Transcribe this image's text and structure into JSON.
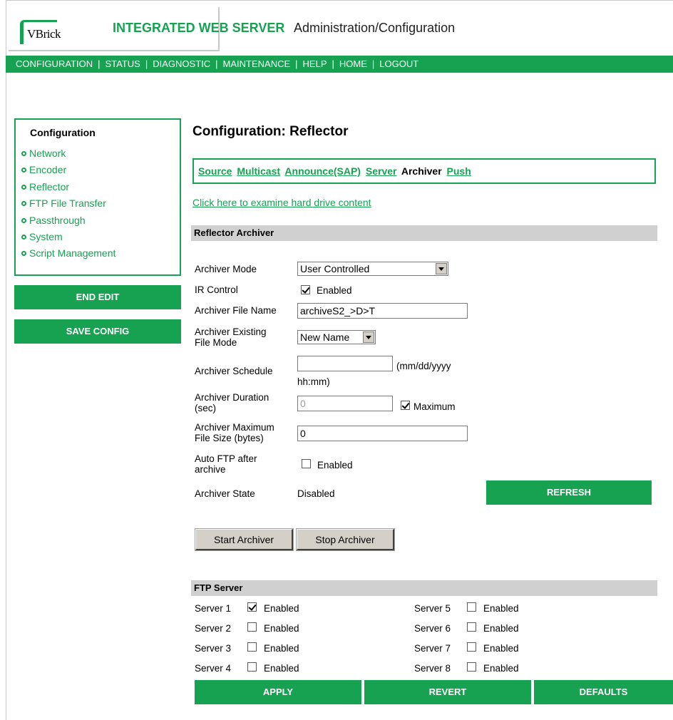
{
  "header": {
    "logo_text": "VBrick",
    "title": "INTEGRATED WEB SERVER",
    "subtitle": "Administration/Configuration"
  },
  "nav": {
    "items": [
      "CONFIGURATION",
      "STATUS",
      "DIAGNOSTIC",
      "MAINTENANCE",
      "HELP",
      "HOME",
      "LOGOUT"
    ]
  },
  "sidebar": {
    "title": "Configuration",
    "items": [
      "Network",
      "Encoder",
      "Reflector",
      "FTP File Transfer",
      "Passthrough",
      "System",
      "Script Management"
    ],
    "end_edit": "END EDIT",
    "save_config": "SAVE CONFIG"
  },
  "page": {
    "title": "Configuration: Reflector",
    "tabs": [
      {
        "label": "Source",
        "active": false
      },
      {
        "label": "Multicast",
        "active": false
      },
      {
        "label": "Announce(SAP)",
        "active": false
      },
      {
        "label": "Server",
        "active": false
      },
      {
        "label": "Archiver",
        "active": true
      },
      {
        "label": "Push",
        "active": false
      }
    ],
    "hd_link": "Click here to examine hard drive content"
  },
  "archiver": {
    "section_title": "Reflector Archiver",
    "mode_label": "Archiver Mode",
    "mode_value": "User Controlled",
    "ir_label": "IR Control",
    "ir_enabled": true,
    "ir_option": "Enabled",
    "file_name_label": "Archiver File Name",
    "file_name_value": "archiveS2_>D>T",
    "existing_mode_label_1": "Archiver Existing",
    "existing_mode_label_2": "File Mode",
    "existing_mode_value": "New Name",
    "schedule_label": "Archiver Schedule",
    "schedule_value": "",
    "schedule_hint_1": "(mm/dd/yyyy",
    "schedule_hint_2": "hh:mm)",
    "duration_label_1": "Archiver Duration",
    "duration_label_2": "(sec)",
    "duration_value": "0",
    "duration_max": "Maximum",
    "duration_max_checked": true,
    "max_size_label_1": "Archiver Maximum",
    "max_size_label_2": "File Size (bytes)",
    "max_size_value": "0",
    "auto_ftp_label_1": "Auto FTP after",
    "auto_ftp_label_2": "archive",
    "auto_ftp_option": "Enabled",
    "auto_ftp_enabled": false,
    "state_label": "Archiver State",
    "state_value": "Disabled",
    "refresh": "REFRESH",
    "start": "Start Archiver",
    "stop": "Stop Archiver"
  },
  "ftp": {
    "section_title": "FTP Server",
    "option_label": "Enabled",
    "servers": [
      {
        "name": "Server 1",
        "enabled": true
      },
      {
        "name": "Server 2",
        "enabled": false
      },
      {
        "name": "Server 3",
        "enabled": false
      },
      {
        "name": "Server 4",
        "enabled": false
      },
      {
        "name": "Server 5",
        "enabled": false
      },
      {
        "name": "Server 6",
        "enabled": false
      },
      {
        "name": "Server 7",
        "enabled": false
      },
      {
        "name": "Server 8",
        "enabled": false
      }
    ]
  },
  "actions": {
    "apply": "APPLY",
    "revert": "REVERT",
    "defaults": "DEFAULTS"
  },
  "colors": {
    "brand_green": "#16a251",
    "section_gray": "#d0d0d0"
  }
}
